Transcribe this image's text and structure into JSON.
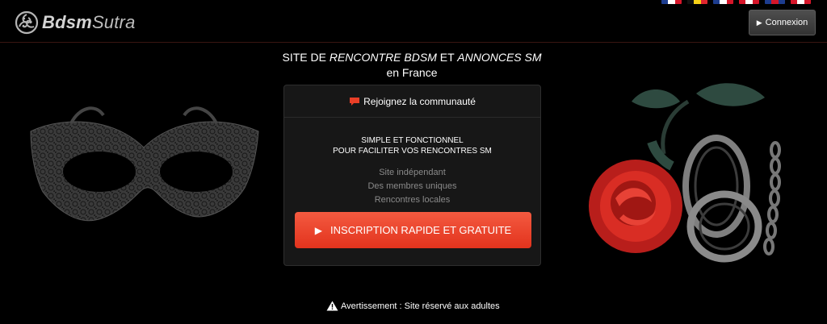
{
  "header": {
    "logo_text_bold": "Bdsm",
    "logo_text_light": "Sutra",
    "login_label": "Connexion"
  },
  "flags": [
    {
      "name": "fr",
      "colors": [
        "#1d3d8f",
        "#ffffff",
        "#d6162a"
      ]
    },
    {
      "name": "be",
      "colors": [
        "#111111",
        "#f7d117",
        "#e0262f"
      ]
    },
    {
      "name": "fr2",
      "colors": [
        "#1d3d8f",
        "#ffffff",
        "#d6162a"
      ]
    },
    {
      "name": "ca",
      "colors": [
        "#d6162a",
        "#ffffff",
        "#d6162a"
      ]
    },
    {
      "name": "uk",
      "colors": [
        "#1d3d8f",
        "#d6162a",
        "#1d3d8f"
      ]
    },
    {
      "name": "ch",
      "colors": [
        "#d6162a",
        "#ffffff",
        "#d6162a"
      ]
    }
  ],
  "headline": {
    "prefix": "SITE DE ",
    "em1": "RENCONTRE BDSM",
    "middle": " ET ",
    "em2": "ANNONCES SM",
    "suffix": " en France"
  },
  "card": {
    "title": "Rejoignez la communauté",
    "subtitle_line1": "SIMPLE ET FONCTIONNEL",
    "subtitle_line2": "POUR FACILITER VOS RENCONTRES SM",
    "features": [
      "Site indépendant",
      "Des membres uniques",
      "Rencontres locales"
    ],
    "cta_label": "INSCRIPTION RAPIDE ET GRATUITE"
  },
  "footer": {
    "warning": "Avertissement : Site réservé aux adultes"
  },
  "colors": {
    "accent": "#ea3f27",
    "background": "#000000",
    "card": "#171717"
  }
}
